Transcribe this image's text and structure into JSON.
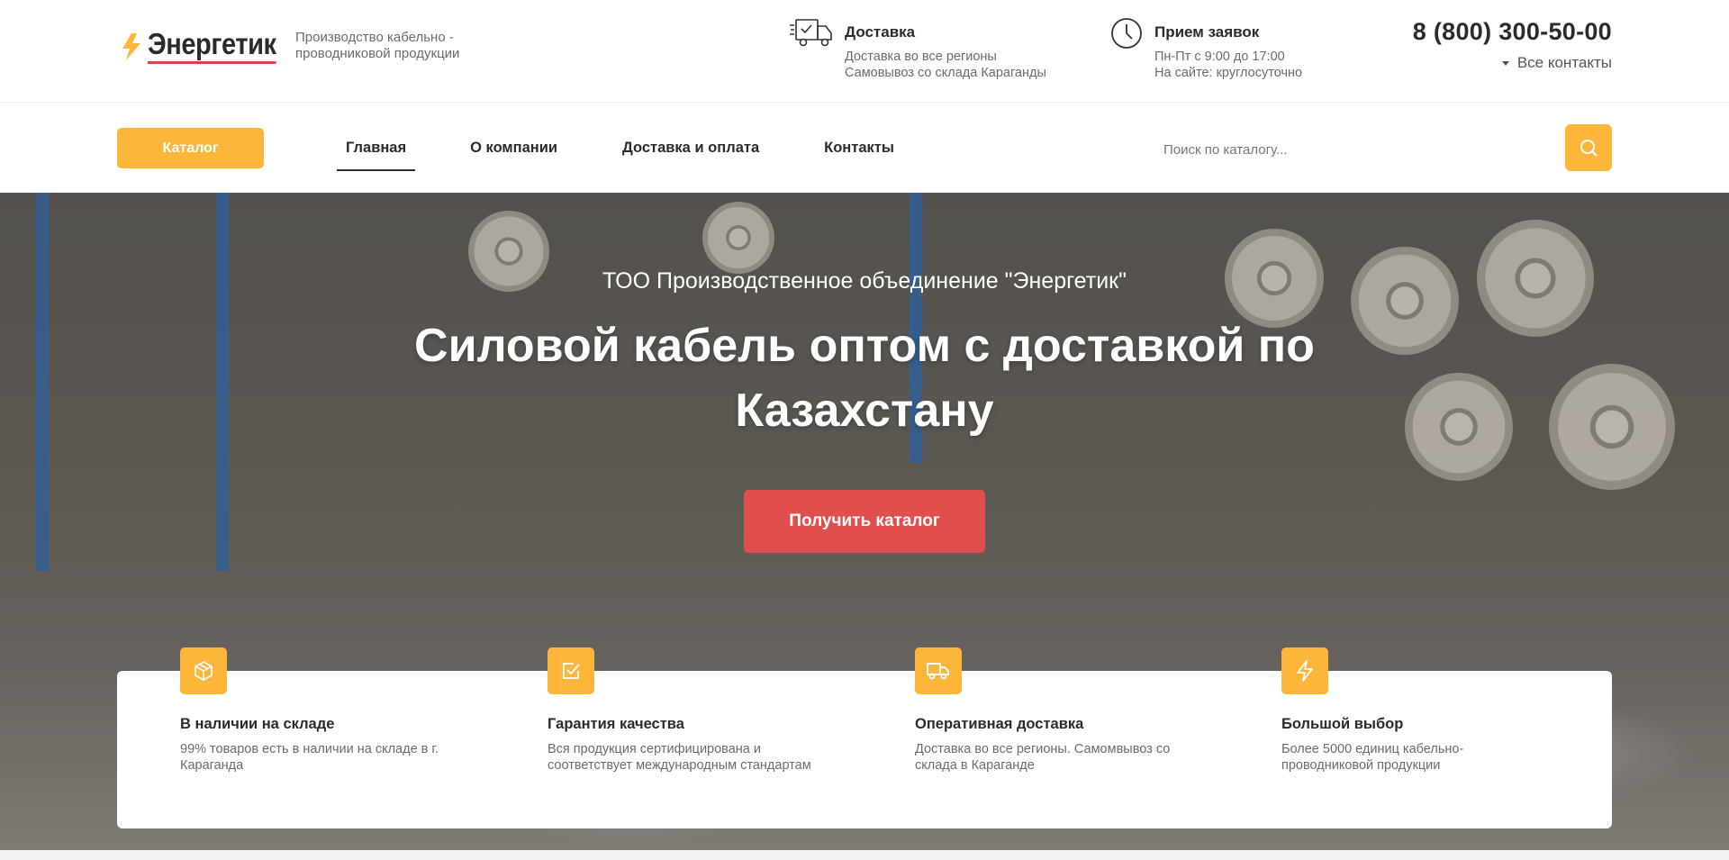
{
  "header": {
    "logo_text": "Энергетик",
    "tagline": "Производство кабельно - проводниковой продукции",
    "delivery": {
      "title": "Доставка",
      "lines": [
        "Доставка во все регионы",
        "Самовывоз со склада Караганды"
      ],
      "icon": "truck-icon"
    },
    "requests": {
      "title": "Прием заявок",
      "lines": [
        "Пн-Пт с 9:00 до 17:00",
        "На сайте: круглосуточно"
      ],
      "icon": "clock-icon"
    },
    "phone": "8 (800) 300-50-00",
    "contacts_link": "Все контакты"
  },
  "nav": {
    "catalog_button": "Каталог",
    "menu": [
      {
        "label": "Главная",
        "active": true
      },
      {
        "label": "О компании",
        "active": false
      },
      {
        "label": "Доставка и оплата",
        "active": false
      },
      {
        "label": "Контакты",
        "active": false
      }
    ],
    "search_placeholder": "Поиск по каталогу..."
  },
  "hero": {
    "subtitle": "ТОО Производственное объединение \"Энергетик\"",
    "title": "Силовой кабель оптом с доставкой по Казахстану",
    "button": "Получить каталог"
  },
  "features": [
    {
      "icon": "box-icon",
      "title": "В наличии на складе",
      "text": "99% товаров есть в наличии на складе в г. Караганда"
    },
    {
      "icon": "checkbox-icon",
      "title": "Гарантия качества",
      "text": "Вся продукция сертифицирована и соответствует международным стандартам"
    },
    {
      "icon": "truck-icon",
      "title": "Оперативная доставка",
      "text": "Доставка во все регионы. Самомвывоз со склада в Караганде"
    },
    {
      "icon": "lightning-icon",
      "title": "Большой выбор",
      "text": "Более 5000 единиц кабельно-проводниковой продукции"
    }
  ],
  "colors": {
    "accent": "#fdb63a",
    "cta": "#e04e4e",
    "text": "#2b2b2b",
    "muted": "#6b6b6b"
  }
}
